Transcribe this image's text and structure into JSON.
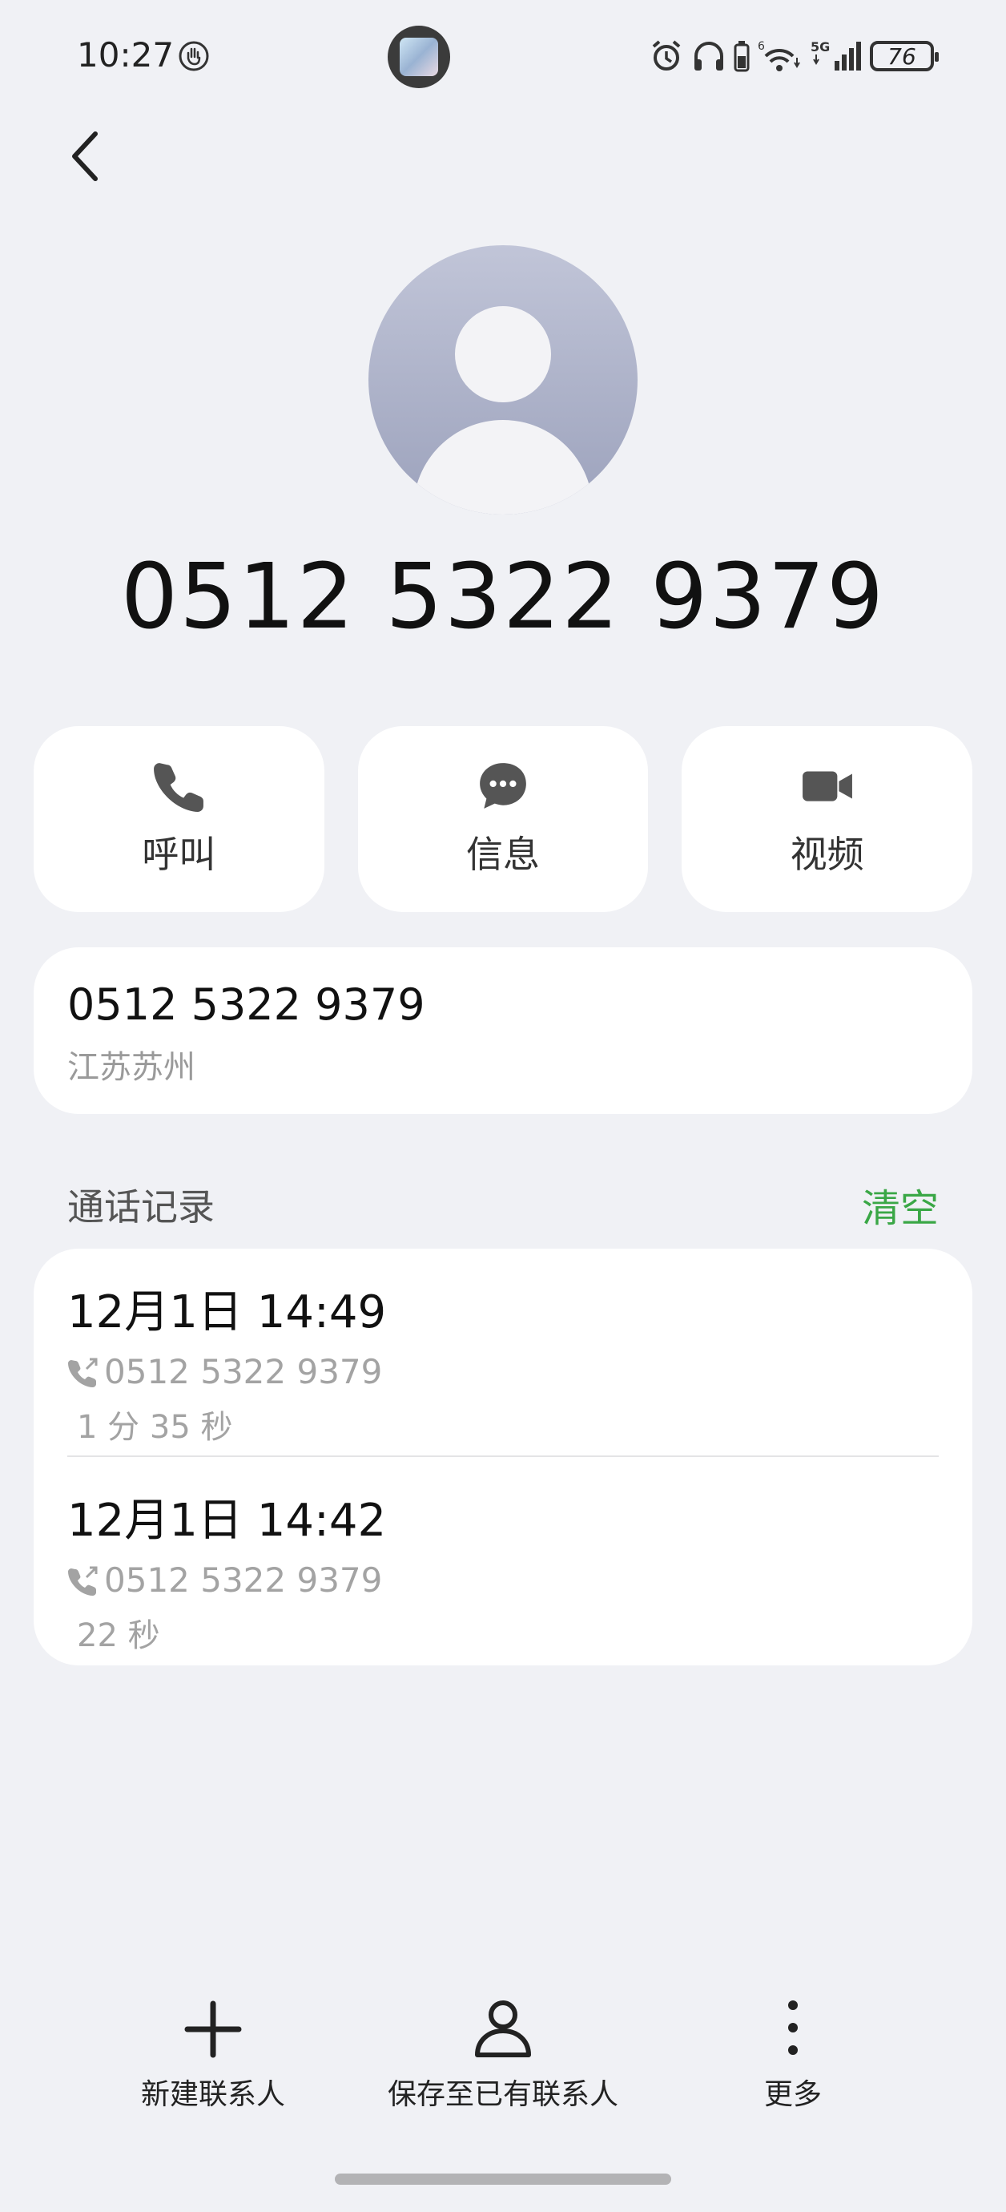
{
  "status_bar": {
    "time": "10:27",
    "battery": "76",
    "network": "5G",
    "icons": [
      "hand-icon",
      "app-thumbnail",
      "alarm-icon",
      "headphones-icon",
      "phone-battery-icon",
      "wifi-icon",
      "signal-icon",
      "battery-icon"
    ]
  },
  "contact": {
    "title": "0512 5322 9379"
  },
  "actions": [
    {
      "label": "呼叫",
      "icon": "phone-icon"
    },
    {
      "label": "信息",
      "icon": "message-icon"
    },
    {
      "label": "视频",
      "icon": "video-icon"
    }
  ],
  "number_card": {
    "number": "0512 5322 9379",
    "location": "江苏苏州"
  },
  "call_log": {
    "title": "通话记录",
    "clear_label": "清空",
    "entries": [
      {
        "date": "12月1日 14:49",
        "number": "0512 5322 9379",
        "duration": "1 分 35 秒"
      },
      {
        "date": "12月1日 14:42",
        "number": "0512 5322 9379",
        "duration": "22 秒"
      }
    ]
  },
  "bottom_bar": {
    "new_contact": "新建联系人",
    "save_existing": "保存至已有联系人",
    "more": "更多"
  },
  "colors": {
    "background": "#f0f1f5",
    "card": "#ffffff",
    "accent_green": "#3aa746",
    "icon_gray": "#555555"
  }
}
